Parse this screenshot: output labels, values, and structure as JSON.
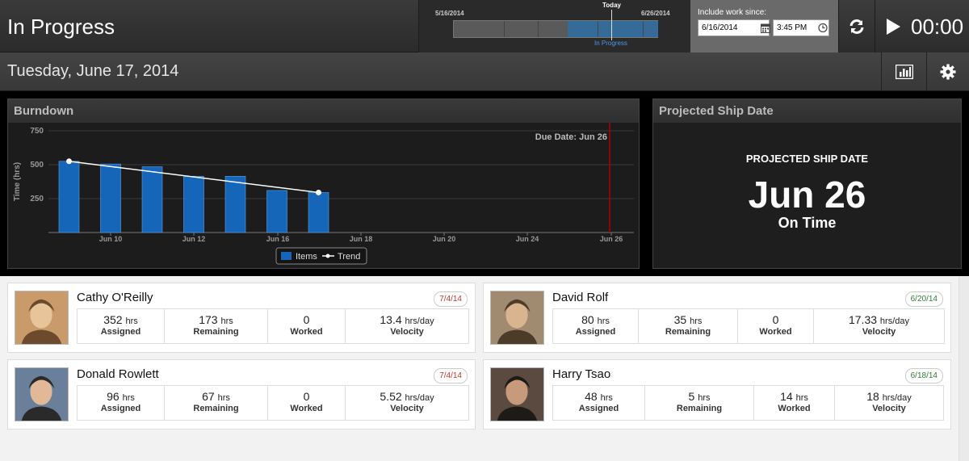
{
  "header": {
    "title": "In Progress",
    "timeline": {
      "start": "5/16/2014",
      "end": "6/26/2014",
      "today": "Today",
      "range_label": "In Progress"
    },
    "since": {
      "label": "Include work since:",
      "date": "6/16/2014",
      "time": "3:45 PM"
    },
    "timer": "00:00"
  },
  "datebar": {
    "date": "Tuesday, June 17, 2014"
  },
  "burndown": {
    "title": "Burndown",
    "due_label": "Due Date: Jun 26",
    "legend_items": "Items",
    "legend_trend": "Trend"
  },
  "ship": {
    "title": "Projected Ship Date",
    "label": "PROJECTED SHIP DATE",
    "date": "Jun 26",
    "status": "On Time"
  },
  "chart_data": {
    "type": "bar",
    "ylabel": "Time (hrs)",
    "ylim": [
      0,
      750
    ],
    "yticks": [
      250,
      500,
      750
    ],
    "xticks": [
      "Jun 10",
      "Jun 12",
      "Jun 16",
      "Jun 18",
      "Jun 20",
      "Jun 24",
      "Jun 26"
    ],
    "series": [
      {
        "name": "Items",
        "type": "bar",
        "values": [
          525,
          505,
          485,
          415,
          415,
          310,
          295
        ]
      },
      {
        "name": "Trend",
        "type": "line",
        "start": 525,
        "end": 295
      }
    ],
    "due_date": "Jun 26",
    "grid": true,
    "legend": "bottom-center"
  },
  "people": [
    {
      "name": "Cathy O'Reilly",
      "due": "7/4/14",
      "status": "late",
      "assigned": "352",
      "remaining": "173",
      "worked": "0",
      "velocity": "13.4"
    },
    {
      "name": "David Rolf",
      "due": "6/20/14",
      "status": "ok",
      "assigned": "80",
      "remaining": "35",
      "worked": "0",
      "velocity": "17.33"
    },
    {
      "name": "Donald Rowlett",
      "due": "7/4/14",
      "status": "late",
      "assigned": "96",
      "remaining": "67",
      "worked": "0",
      "velocity": "5.52"
    },
    {
      "name": "Harry Tsao",
      "due": "6/18/14",
      "status": "ok",
      "assigned": "48",
      "remaining": "5",
      "worked": "14",
      "velocity": "18"
    }
  ],
  "labels": {
    "hrs": "hrs",
    "hrs_day": "hrs/day",
    "assigned": "Assigned",
    "remaining": "Remaining",
    "worked": "Worked",
    "velocity": "Velocity"
  },
  "colors": {
    "bar": "#1565b8",
    "late": "#c0392b",
    "ok": "#2e7d32"
  }
}
